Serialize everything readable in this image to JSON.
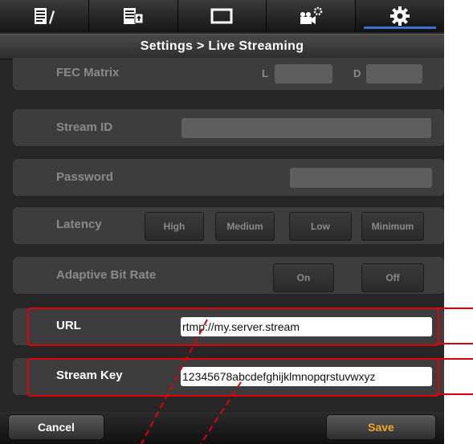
{
  "tabs": [
    {
      "icon": "document-edit-icon"
    },
    {
      "icon": "document-export-icon"
    },
    {
      "icon": "screen-icon"
    },
    {
      "icon": "camera-settings-icon"
    },
    {
      "icon": "gear-icon",
      "active": true
    }
  ],
  "title": "Settings > Live Streaming",
  "fec": {
    "label": "FEC Matrix",
    "l_label": "L",
    "d_label": "D"
  },
  "stream_id": {
    "label": "Stream ID",
    "value": ""
  },
  "password": {
    "label": "Password",
    "value": ""
  },
  "latency": {
    "label": "Latency",
    "options": [
      "High",
      "Medium",
      "Low",
      "Minimum"
    ]
  },
  "adaptive": {
    "label": "Adaptive Bit Rate",
    "on": "On",
    "off": "Off"
  },
  "url": {
    "label": "URL",
    "value": "rtmp://my.server.stream"
  },
  "stream_key": {
    "label": "Stream Key",
    "value": "12345678abcdefghijklmnopqrstuvwxyz"
  },
  "bottom": {
    "cancel": "Cancel",
    "save": "Save"
  },
  "colors": {
    "annotation": "#e0000a",
    "save_text": "#f5a623",
    "active_tab_indicator": "#3b6fd0"
  }
}
